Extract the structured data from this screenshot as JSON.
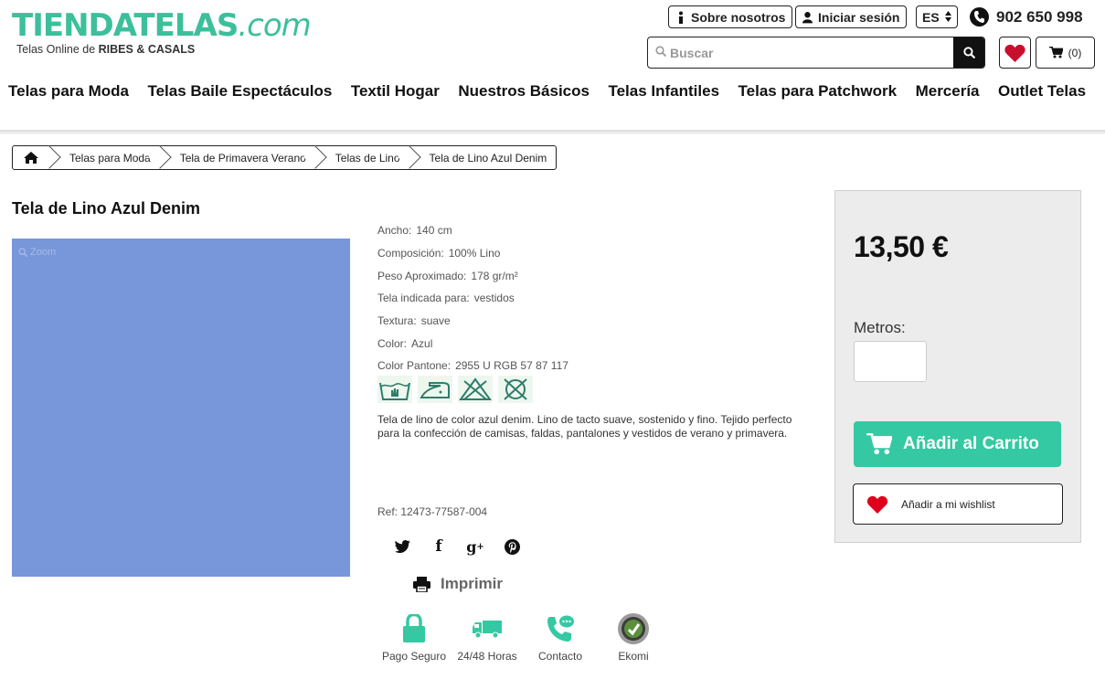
{
  "header": {
    "logo_main": "TIENDATELAS",
    "logo_suffix": ".com",
    "logo_sub_prefix": "Telas Online de",
    "logo_sub_brand": "RIBES & CASALS",
    "about_label": "Sobre nosotros",
    "login_label": "Iniciar sesión",
    "language": "ES",
    "phone": "902 650 998",
    "search_placeholder": "Buscar",
    "cart_count": "(0)"
  },
  "nav": {
    "items": [
      "Telas para Moda",
      "Telas Baile Espectáculos",
      "Textil Hogar",
      "Nuestros Básicos",
      "Telas Infantiles",
      "Telas para Patchwork",
      "Mercería",
      "Outlet Telas"
    ]
  },
  "breadcrumb": {
    "items": [
      "Telas para Moda",
      "Tela de Primavera Verano",
      "Telas de Lino",
      "Tela de Lino Azul Denim"
    ]
  },
  "product": {
    "title": "Tela de Lino Azul Denim",
    "zoom_label": "Zoom",
    "image_color": "#7896da",
    "specs": [
      {
        "label": "Ancho:",
        "value": "140 cm"
      },
      {
        "label": "Composición:",
        "value": "100% Lino"
      },
      {
        "label": "Peso Aproximado:",
        "value": "178 gr/m²"
      },
      {
        "label": "Tela indicada para:",
        "value": "vestidos"
      },
      {
        "label": "Textura:",
        "value": "suave"
      },
      {
        "label": "Color:",
        "value": "Azul"
      },
      {
        "label": "Color Pantone:",
        "value": "2955 U RGB 57 87 117"
      }
    ],
    "care_icons": [
      "hand-wash-icon",
      "iron-icon",
      "no-bleach-icon",
      "no-dry-clean-icon"
    ],
    "description": "Tela de lino de color azul denim. Lino de tacto suave, sostenido y fino. Tejido perfecto para la confección de camisas, faldas, pantalones y vestidos de verano y primavera.",
    "ref": "Ref: 12473-77587-004",
    "print_label": "Imprimir"
  },
  "trust": [
    {
      "label": "Pago Seguro",
      "icon": "lock-icon"
    },
    {
      "label": "24/48 Horas",
      "icon": "truck-icon"
    },
    {
      "label": "Contacto",
      "icon": "phone-chat-icon"
    },
    {
      "label": "Ekomi",
      "icon": "ekomi-seal-icon"
    }
  ],
  "buy": {
    "price": "13,50 €",
    "qty_label": "Metros:",
    "add_to_cart": "Añadir al Carrito",
    "wishlist_label": "Añadir a mi wishlist"
  },
  "colors": {
    "brand": "#3dbf9c",
    "cta": "#34c9a2",
    "heart": "#d0021b"
  }
}
